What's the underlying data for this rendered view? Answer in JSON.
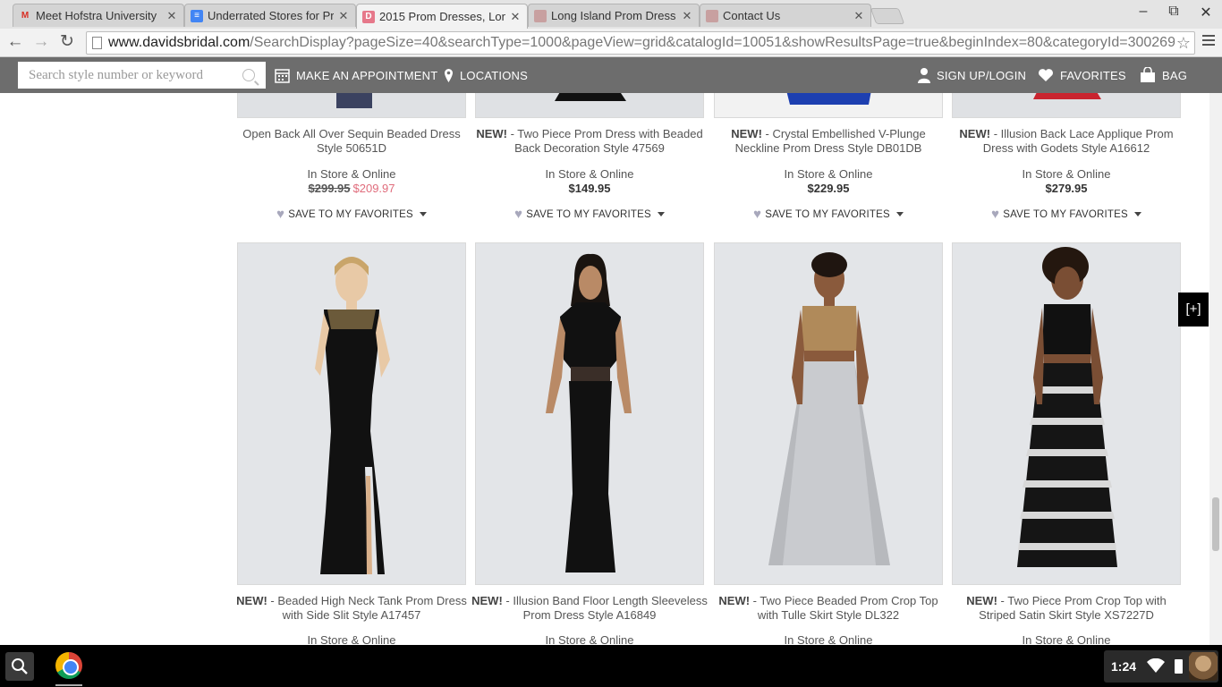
{
  "browser": {
    "tabs": [
      {
        "title": "Meet Hofstra University",
        "favicon": "gmail-icon",
        "active": false
      },
      {
        "title": "Underrated Stores for Pr",
        "favicon": "docs-icon",
        "active": false
      },
      {
        "title": "2015 Prom Dresses, Lon",
        "favicon": "davidsbridal-icon",
        "active": true
      },
      {
        "title": "Long Island Prom Dress",
        "favicon": "site-icon",
        "active": false
      },
      {
        "title": "Contact Us",
        "favicon": "site-icon",
        "active": false
      }
    ],
    "url_host": "www.davidsbridal.com",
    "url_path": "/SearchDisplay?pageSize=40&searchType=1000&pageView=grid&catalogId=10051&showResultsPage=true&beginIndex=80&categoryId=300269"
  },
  "header": {
    "search_placeholder": "Search style number or keyword",
    "appointment": "MAKE AN APPOINTMENT",
    "locations": "LOCATIONS",
    "signup": "SIGN UP/LOGIN",
    "favorites": "FAVORITES",
    "bag": "BAG"
  },
  "products_top": [
    {
      "prefix": "",
      "name": "Open Back All Over Sequin Beaded Dress Style 50651D",
      "availability": "In Store & Online",
      "was_price": "$299.95",
      "price": "$209.97",
      "favorite": "SAVE TO MY FAVORITES"
    },
    {
      "prefix": "NEW!",
      "name": " - Two Piece Prom Dress with Beaded Back Decoration Style 47569",
      "availability": "In Store & Online",
      "was_price": "",
      "price": "$149.95",
      "favorite": "SAVE TO MY FAVORITES"
    },
    {
      "prefix": "NEW!",
      "name": " - Crystal Embellished V-Plunge Neckline Prom Dress Style DB01DB",
      "availability": "In Store & Online",
      "was_price": "",
      "price": "$229.95",
      "favorite": "SAVE TO MY FAVORITES"
    },
    {
      "prefix": "NEW!",
      "name": " - Illusion Back Lace Applique Prom Dress with Godets Style A16612",
      "availability": "In Store & Online",
      "was_price": "",
      "price": "$279.95",
      "favorite": "SAVE TO MY FAVORITES"
    }
  ],
  "products_bottom": [
    {
      "prefix": "NEW!",
      "name": " - Beaded High Neck Tank Prom Dress with Side Slit Style A17457",
      "availability": "In Store & Online"
    },
    {
      "prefix": "NEW!",
      "name": " - Illusion Band Floor Length Sleeveless Prom Dress Style A16849",
      "availability": "In Store & Online"
    },
    {
      "prefix": "NEW!",
      "name": " - Two Piece Beaded Prom Crop Top with Tulle Skirt Style DL322",
      "availability": "In Store & Online"
    },
    {
      "prefix": "NEW!",
      "name": " - Two Piece Prom Crop Top with Striped Satin Skirt Style XS7227D",
      "availability": "In Store & Online"
    }
  ],
  "expand_button": "[+]",
  "shelf": {
    "clock": "1:24"
  },
  "colors": {
    "header_bg": "#6d6d6d",
    "sale_price": "#e06c7c",
    "favorite_heart": "#a8a8bc"
  }
}
